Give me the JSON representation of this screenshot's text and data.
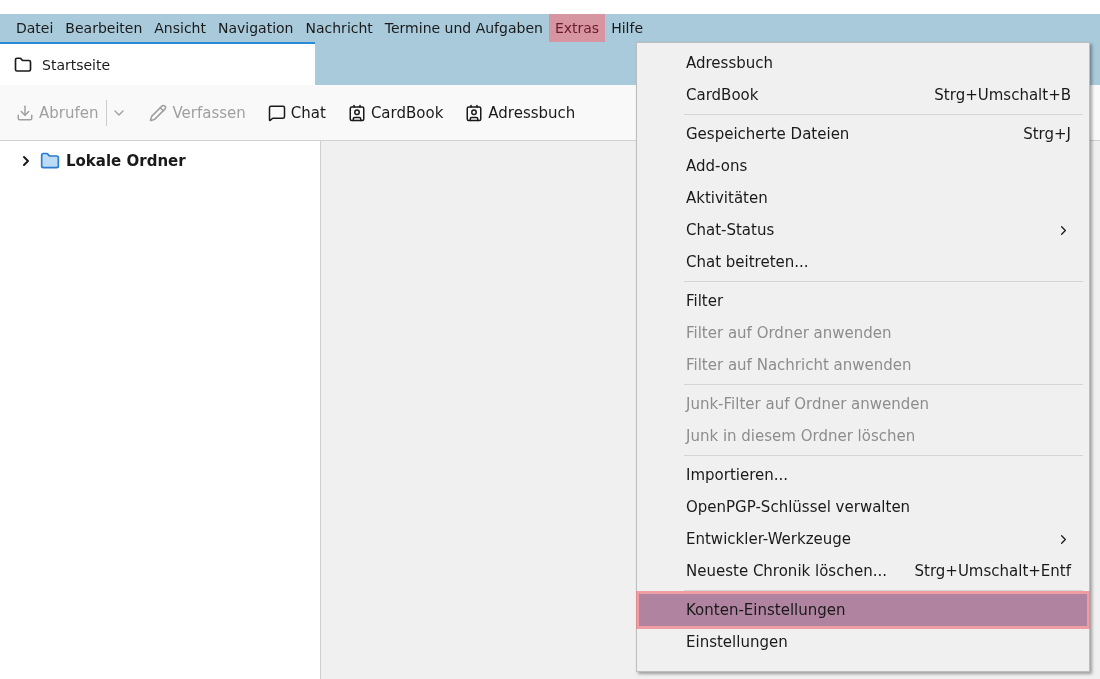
{
  "menubar": [
    {
      "label": "Datei",
      "selected": false
    },
    {
      "label": "Bearbeiten",
      "selected": false
    },
    {
      "label": "Ansicht",
      "selected": false
    },
    {
      "label": "Navigation",
      "selected": false
    },
    {
      "label": "Nachricht",
      "selected": false
    },
    {
      "label": "Termine und Aufgaben",
      "selected": false
    },
    {
      "label": "Extras",
      "selected": true
    },
    {
      "label": "Hilfe",
      "selected": false
    }
  ],
  "tabs": [
    {
      "label": "Startseite",
      "selected": true
    }
  ],
  "toolbar": [
    {
      "label": "Abrufen",
      "kind": "get",
      "disabled": true,
      "dropdown": true
    },
    {
      "label": "Verfassen",
      "kind": "write",
      "disabled": true,
      "dropdown": false
    },
    {
      "label": "Chat",
      "kind": "chat",
      "disabled": false,
      "dropdown": false
    },
    {
      "label": "CardBook",
      "kind": "cardbook",
      "disabled": false,
      "dropdown": false
    },
    {
      "label": "Adressbuch",
      "kind": "addressbook",
      "disabled": false,
      "dropdown": false
    }
  ],
  "folders": [
    {
      "label": "Lokale Ordner",
      "expanded": false
    }
  ],
  "menu": [
    {
      "kind": "item",
      "label": "Adressbuch",
      "disabled": false,
      "selected": false
    },
    {
      "kind": "item",
      "label": "CardBook",
      "shortcut": "Strg+Umschalt+B",
      "disabled": false,
      "selected": false
    },
    {
      "kind": "separator"
    },
    {
      "kind": "item",
      "label": "Gespeicherte Dateien",
      "shortcut": "Strg+J",
      "disabled": false,
      "selected": false
    },
    {
      "kind": "item",
      "label": "Add-ons",
      "disabled": false,
      "selected": false
    },
    {
      "kind": "item",
      "label": "Aktivitäten",
      "disabled": false,
      "selected": false
    },
    {
      "kind": "submenu",
      "label": "Chat-Status",
      "disabled": false,
      "selected": false
    },
    {
      "kind": "item",
      "label": "Chat beitreten...",
      "disabled": false,
      "selected": false
    },
    {
      "kind": "separator"
    },
    {
      "kind": "item",
      "label": "Filter",
      "disabled": false,
      "selected": false
    },
    {
      "kind": "item",
      "label": "Filter auf Ordner anwenden",
      "disabled": true,
      "selected": false
    },
    {
      "kind": "item",
      "label": "Filter auf Nachricht anwenden",
      "disabled": true,
      "selected": false
    },
    {
      "kind": "separator"
    },
    {
      "kind": "item",
      "label": "Junk-Filter auf Ordner anwenden",
      "disabled": true,
      "selected": false
    },
    {
      "kind": "item",
      "label": "Junk in diesem Ordner löschen",
      "disabled": true,
      "selected": false
    },
    {
      "kind": "separator"
    },
    {
      "kind": "item",
      "label": "Importieren...",
      "disabled": false,
      "selected": false
    },
    {
      "kind": "item",
      "label": "OpenPGP-Schlüssel verwalten",
      "disabled": false,
      "selected": false
    },
    {
      "kind": "submenu",
      "label": "Entwickler-Werkzeuge",
      "disabled": false,
      "selected": false
    },
    {
      "kind": "item",
      "label": "Neueste Chronik löschen...",
      "shortcut": "Strg+Umschalt+Entf",
      "disabled": false,
      "selected": false
    },
    {
      "kind": "separator"
    },
    {
      "kind": "item",
      "label": "Konten-Einstellungen",
      "disabled": false,
      "selected": true
    },
    {
      "kind": "item",
      "label": "Einstellungen",
      "disabled": false,
      "selected": false
    }
  ]
}
